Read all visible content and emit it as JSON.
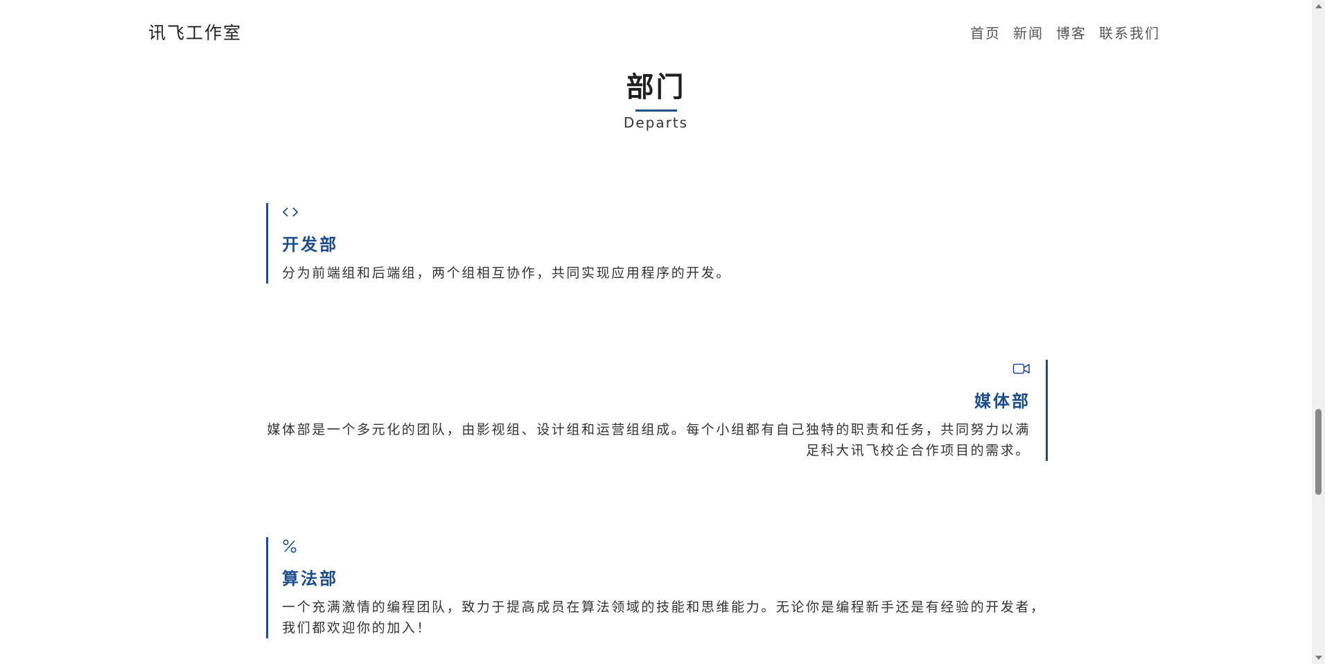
{
  "header": {
    "brand": "讯飞工作室",
    "nav": [
      {
        "label": "首页"
      },
      {
        "label": "新闻"
      },
      {
        "label": "博客"
      },
      {
        "label": "联系我们"
      }
    ]
  },
  "section": {
    "title": "部门",
    "subtitle": "Departs"
  },
  "departments": [
    {
      "icon": "code-icon",
      "name": "开发部",
      "description": "分为前端组和后端组，两个组相互协作，共同实现应用程序的开发。"
    },
    {
      "icon": "video-camera-icon",
      "name": "媒体部",
      "description": "媒体部是一个多元化的团队，由影视组、设计组和运营组组成。每个小组都有自己独特的职责和任务，共同努力以满足科大讯飞校企合作项目的需求。"
    },
    {
      "icon": "percent-icon",
      "name": "算法部",
      "description": "一个充满激情的编程团队，致力于提高成员在算法领域的技能和思维能力。无论你是编程新手还是有经验的开发者，我们都欢迎你的加入！"
    }
  ],
  "colors": {
    "accent": "#1b4c8c",
    "text": "#333333",
    "background": "#ffffff"
  }
}
